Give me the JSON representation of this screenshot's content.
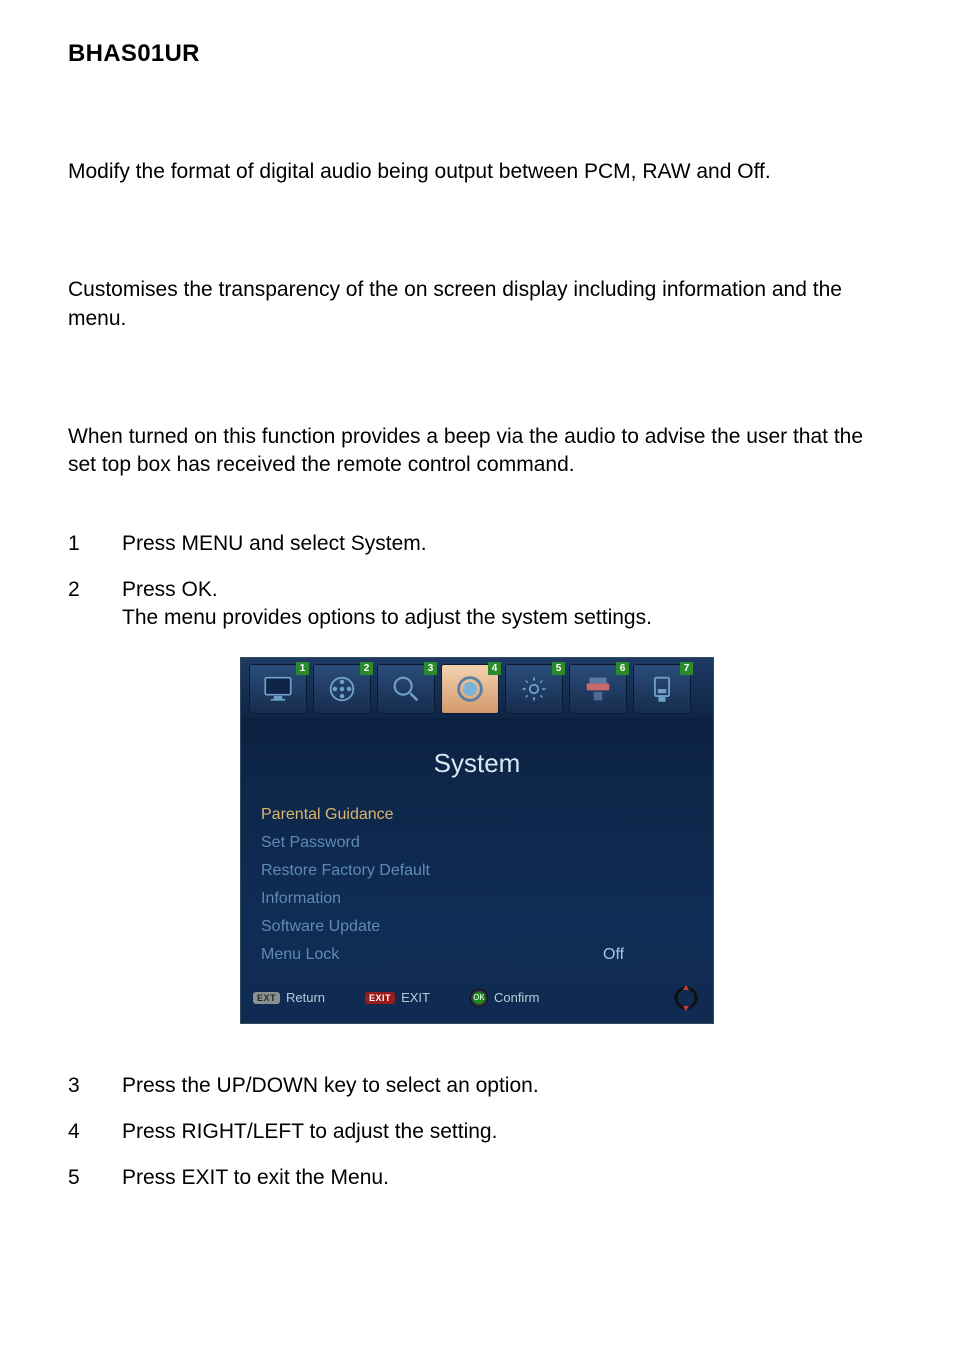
{
  "header": {
    "title": "BHAS01UR"
  },
  "paras": {
    "p1": "Modify the format of digital audio being output between PCM, RAW and Off.",
    "p2": "Customises the transparency of the on screen display including information and the menu.",
    "p3": "When turned on this function provides a beep via the audio to advise the user that the set top box has received the remote control command."
  },
  "steps_a": {
    "s1_num": "1",
    "s1_txt": "Press MENU and select System.",
    "s2_num": "2",
    "s2_txt": "Press OK.",
    "s2_sub": "The menu provides options to adjust the system settings."
  },
  "steps_b": {
    "s3_num": "3",
    "s3_txt": "Press the UP/DOWN key to select an option.",
    "s4_num": "4",
    "s4_txt": "Press RIGHT/LEFT to adjust the setting.",
    "s5_num": "5",
    "s5_txt": "Press EXIT to exit the Menu."
  },
  "screenshot": {
    "tabs": {
      "n1": "1",
      "n2": "2",
      "n3": "3",
      "n4": "4",
      "n5": "5",
      "n6": "6",
      "n7": "7"
    },
    "title": "System",
    "menu": {
      "m1": "Parental Guidance",
      "m2": "Set Password",
      "m3": "Restore Factory Default",
      "m4": "Information",
      "m5": "Software Update",
      "m6": "Menu Lock",
      "m6_val": "Off"
    },
    "footer": {
      "return_chip": "EXT",
      "return_label": "Return",
      "exit_chip": "EXIT",
      "exit_label": "EXIT",
      "ok_chip": "OK",
      "confirm_label": "Confirm"
    }
  }
}
